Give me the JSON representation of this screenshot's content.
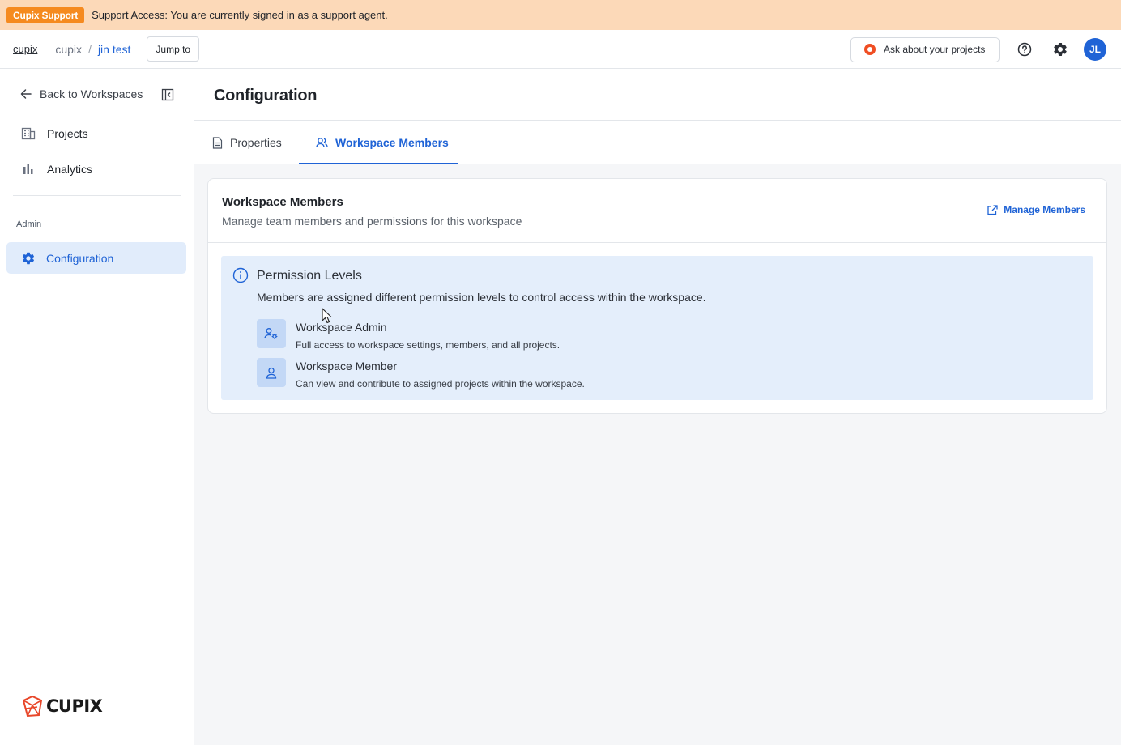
{
  "banner": {
    "badge": "Cupix Support",
    "message": "Support Access: You are currently signed in as a support agent."
  },
  "topbar": {
    "org_link": "cupix",
    "breadcrumb": [
      "cupix",
      "jin test"
    ],
    "separator": "/",
    "jump_label": "Jump to",
    "ask_label": "Ask about your projects",
    "avatar_initials": "JL"
  },
  "sidebar": {
    "back_label": "Back to Workspaces",
    "items": [
      {
        "label": "Projects",
        "icon": "grid-building-icon"
      },
      {
        "label": "Analytics",
        "icon": "bar-chart-icon"
      }
    ],
    "admin_label": "Admin",
    "active_item": {
      "label": "Configuration",
      "icon": "gear-icon"
    },
    "logo_text": "CUPIX"
  },
  "main": {
    "title": "Configuration",
    "tabs": [
      {
        "label": "Properties",
        "icon": "document-icon",
        "active": false
      },
      {
        "label": "Workspace Members",
        "icon": "users-icon",
        "active": true
      }
    ],
    "card": {
      "title": "Workspace Members",
      "subtitle": "Manage team members and permissions for this workspace",
      "manage_label": "Manage Members",
      "info": {
        "title": "Permission Levels",
        "description": "Members are assigned different permission levels to control access within the workspace.",
        "roles": [
          {
            "name": "Workspace Admin",
            "description": "Full access to workspace settings, members, and all projects.",
            "icon": "user-gear-icon"
          },
          {
            "name": "Workspace Member",
            "description": "Can view and contribute to assigned projects within the workspace.",
            "icon": "user-icon"
          }
        ]
      }
    }
  },
  "colors": {
    "accent": "#1f63d6",
    "banner_bg": "#fcd9b8",
    "badge_bg": "#f58a1f",
    "info_bg": "#e4eefb"
  }
}
